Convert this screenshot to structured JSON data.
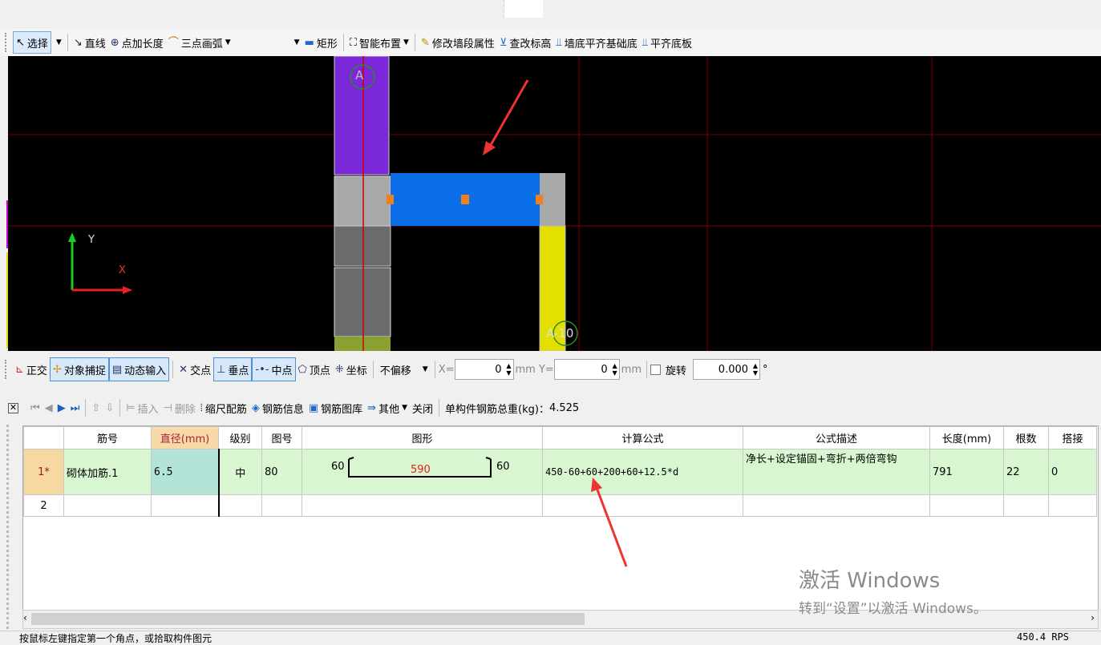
{
  "toolbar": {
    "select": "选择",
    "line": "直线",
    "point_length": "点加长度",
    "three_point_arc": "三点画弧",
    "rectangle": "矩形",
    "smart_layout": "智能布置",
    "modify_wall_props": "修改墙段属性",
    "check_elevation": "查改标高",
    "wall_base_align": "墙底平齐基础底",
    "align_slab_bottom": "平齐底板"
  },
  "canvas": {
    "axis_y": "Y",
    "axis_x": "X",
    "label_top": "A",
    "label_bottom": "A-10",
    "colors": {
      "background": "#000000",
      "purple": "#7a28d8",
      "blue": "#0a6ee8",
      "yellow": "#e3e000",
      "grid_red": "#8b0000"
    }
  },
  "snapbar": {
    "ortho": "正交",
    "object_snap": "对象捕捉",
    "dynamic_input": "动态输入",
    "intersection": "交点",
    "perpendicular": "垂点",
    "midpoint": "中点",
    "vertex": "顶点",
    "coordinate": "坐标",
    "offset": "不偏移",
    "x_label": "X=",
    "x_value": "0",
    "x_unit": "mm",
    "y_label": "Y=",
    "y_value": "0",
    "y_unit": "mm",
    "rotate": "旋转",
    "rotate_value": "0.000",
    "degree": "°"
  },
  "rebar_toolbar": {
    "insert": "插入",
    "delete": "删除",
    "scale_rebar": "缩尺配筋",
    "rebar_info": "钢筋信息",
    "rebar_library": "钢筋图库",
    "other": "其他",
    "close": "关闭",
    "total_weight_label": "单构件钢筋总重(kg)：",
    "total_weight": "4.525"
  },
  "table": {
    "headers": [
      "",
      "筋号",
      "直径(mm)",
      "级别",
      "图号",
      "图形",
      "计算公式",
      "公式描述",
      "长度(mm)",
      "根数",
      "搭接"
    ],
    "rows": [
      {
        "no": "1*",
        "name": "砌体加筋.1",
        "diameter": "6.5",
        "grade": "中",
        "fig_no": "80",
        "shape_left": "60",
        "shape_mid": "590",
        "shape_right": "60",
        "formula": "450-60+60+200+60+12.5*d",
        "desc": "净长+设定锚固+弯折+两倍弯钩",
        "length": "791",
        "count": "22",
        "lap": "0"
      },
      {
        "no": "2",
        "name": "",
        "diameter": "",
        "grade": "",
        "fig_no": "",
        "shape_left": "",
        "shape_mid": "",
        "shape_right": "",
        "formula": "",
        "desc": "",
        "length": "",
        "count": "",
        "lap": ""
      }
    ]
  },
  "status": {
    "text": "按鼠标左键指定第一个角点，或拾取构件图元",
    "right": "450.4 RPS"
  },
  "watermark": {
    "line1": "激活 Windows",
    "line2": "转到“设置”以激活 Windows。"
  }
}
